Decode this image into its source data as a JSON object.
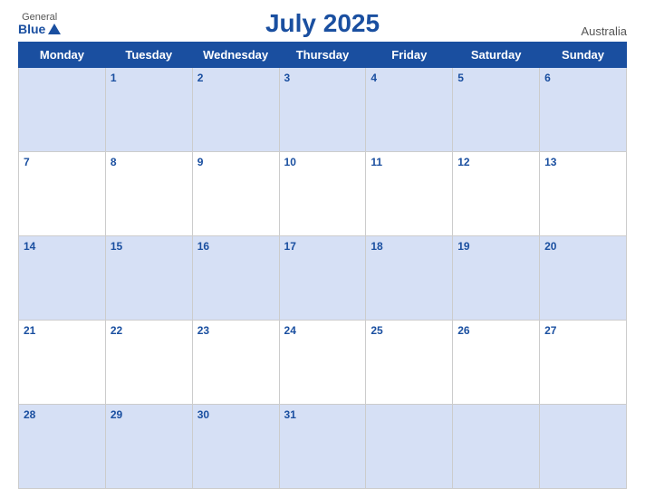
{
  "header": {
    "logo_general": "General",
    "logo_blue": "Blue",
    "title": "July 2025",
    "country": "Australia"
  },
  "days_of_week": [
    "Monday",
    "Tuesday",
    "Wednesday",
    "Thursday",
    "Friday",
    "Saturday",
    "Sunday"
  ],
  "weeks": [
    [
      "",
      "1",
      "2",
      "3",
      "4",
      "5",
      "6"
    ],
    [
      "7",
      "8",
      "9",
      "10",
      "11",
      "12",
      "13"
    ],
    [
      "14",
      "15",
      "16",
      "17",
      "18",
      "19",
      "20"
    ],
    [
      "21",
      "22",
      "23",
      "24",
      "25",
      "26",
      "27"
    ],
    [
      "28",
      "29",
      "30",
      "31",
      "",
      "",
      ""
    ]
  ]
}
